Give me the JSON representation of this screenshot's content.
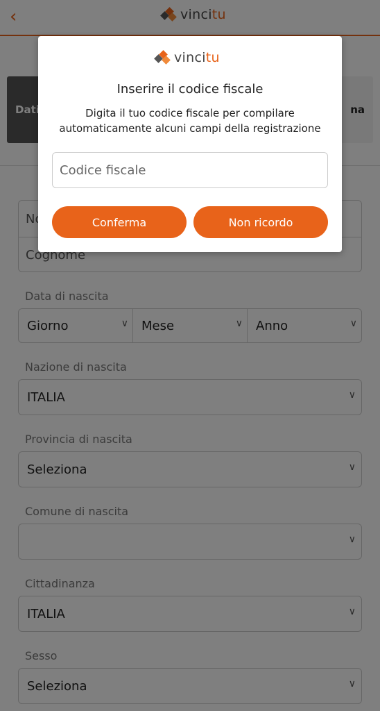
{
  "header": {
    "back_icon": "chevron-left-icon",
    "brand": {
      "prefix": "vinci",
      "suffix": "tu"
    }
  },
  "stepper": {
    "first_step": "Dati",
    "last_step": "na"
  },
  "form": {
    "first_name_partial": "No",
    "last_name": "Cognome",
    "birth_date": {
      "label": "Data di nascita",
      "day": "Giorno",
      "month": "Mese",
      "year": "Anno"
    },
    "birth_nation": {
      "label": "Nazione di nascita",
      "value": "ITALIA"
    },
    "birth_province": {
      "label": "Provincia di nascita",
      "value": "Seleziona"
    },
    "birth_city": {
      "label": "Comune di nascita",
      "value": ""
    },
    "citizenship": {
      "label": "Cittadinanza",
      "value": "ITALIA"
    },
    "gender": {
      "label": "Sesso",
      "value": "Seleziona"
    }
  },
  "modal": {
    "brand": {
      "prefix": "vinci",
      "suffix": "tu"
    },
    "title": "Inserire il codice fiscale",
    "description": "Digita il tuo codice fiscale per compilare automaticamente alcuni campi della registrazione",
    "input_placeholder": "Codice fiscale",
    "input_value": "",
    "confirm_label": "Conferma",
    "forgot_label": "Non ricordo"
  },
  "colors": {
    "accent": "#e8631a",
    "overlay": "rgba(0,0,0,0.5)"
  }
}
